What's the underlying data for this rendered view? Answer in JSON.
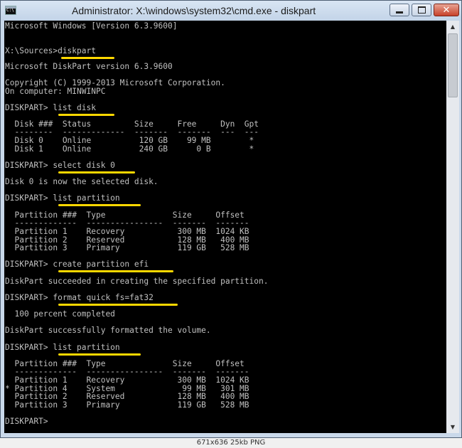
{
  "window": {
    "title": "Administrator: X:\\windows\\system32\\cmd.exe - diskpart",
    "minimize_icon": "minimize-icon",
    "maximize_icon": "maximize-icon",
    "close_icon": "close-icon",
    "close_glyph": "✕"
  },
  "console": {
    "lines": [
      "Microsoft Windows [Version 6.3.9600]",
      "X:\\Sources>diskpart",
      "Microsoft DiskPart version 6.3.9600",
      "Copyright (C) 1999-2013 Microsoft Corporation.",
      "On computer: MINWINPC",
      "DISKPART> list disk",
      "  Disk ###  Status         Size     Free     Dyn  Gpt",
      "  --------  -------------  -------  -------  ---  ---",
      "  Disk 0    Online          120 GB    99 MB        *",
      "  Disk 1    Online          240 GB      0 B        *",
      "DISKPART> select disk 0",
      "Disk 0 is now the selected disk.",
      "DISKPART> list partition",
      "  Partition ###  Type              Size     Offset",
      "  -------------  ----------------  -------  -------",
      "  Partition 1    Recovery           300 MB  1024 KB",
      "  Partition 2    Reserved           128 MB   400 MB",
      "  Partition 3    Primary            119 GB   528 MB",
      "DISKPART> create partition efi",
      "DiskPart succeeded in creating the specified partition.",
      "DISKPART> format quick fs=fat32",
      "  100 percent completed",
      "DiskPart successfully formatted the volume.",
      "DISKPART> list partition",
      "  Partition ###  Type              Size     Offset",
      "  -------------  ----------------  -------  -------",
      "  Partition 1    Recovery           300 MB  1024 KB",
      "* Partition 4    System              99 MB   301 MB",
      "  Partition 2    Reserved           128 MB   400 MB",
      "  Partition 3    Primary            119 GB   528 MB",
      "DISKPART>"
    ]
  },
  "scrollbar": {
    "up_glyph": "▲",
    "down_glyph": "▼"
  },
  "caption": "671x636 25kb PNG",
  "colors": {
    "console_bg": "#000000",
    "console_text": "#c0c0c0",
    "highlight": "#ffd800"
  }
}
